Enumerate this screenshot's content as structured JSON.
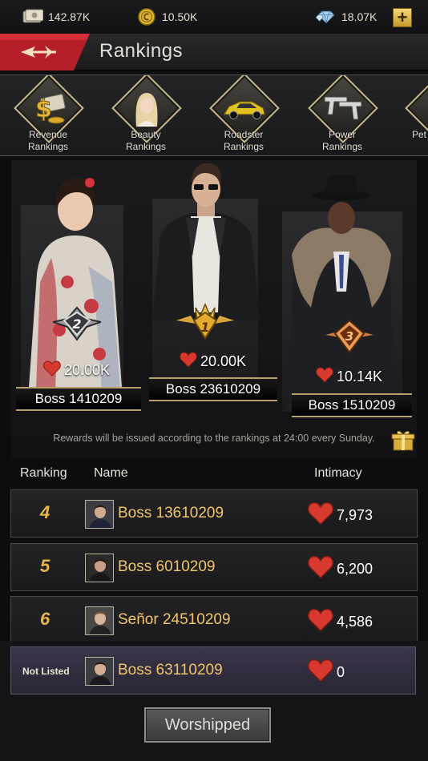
{
  "resources": {
    "money": "142.87K",
    "gold": "10.50K",
    "diamonds": "18.07K"
  },
  "header": {
    "title": "Rankings"
  },
  "categories": [
    {
      "label_line1": "Revenue",
      "label_line2": "Rankings",
      "icon": "money-icon"
    },
    {
      "label_line1": "Beauty",
      "label_line2": "Rankings",
      "icon": "beauty-icon"
    },
    {
      "label_line1": "Roadster",
      "label_line2": "Rankings",
      "icon": "car-icon"
    },
    {
      "label_line1": "Power",
      "label_line2": "Rankings",
      "icon": "guns-icon"
    },
    {
      "label_line1": "Pet",
      "label_line2": "",
      "icon": "pet-icon"
    }
  ],
  "podium": {
    "first": {
      "rank": "1",
      "likes": "20.00K",
      "name": "Boss 23610209"
    },
    "second": {
      "rank": "2",
      "likes": "20.00K",
      "name": "Boss 1410209"
    },
    "third": {
      "rank": "3",
      "likes": "10.14K",
      "name": "Boss 1510209"
    },
    "rewards_note": "Rewards will be issued according to the rankings at 24:00 every Sunday."
  },
  "table": {
    "headers": {
      "ranking": "Ranking",
      "name": "Name",
      "intimacy": "Intimacy"
    },
    "rows": [
      {
        "rank": "4",
        "name": "Boss 13610209",
        "intimacy": "7,973"
      },
      {
        "rank": "5",
        "name": "Boss 6010209",
        "intimacy": "6,200"
      },
      {
        "rank": "6",
        "name": "Señor 24510209",
        "intimacy": "4,586"
      }
    ]
  },
  "my_rank": {
    "status": "Not Listed",
    "name": "Boss 63110209",
    "intimacy": "0"
  },
  "worship_button": "Worshipped",
  "colors": {
    "gold_text": "#f0c46a",
    "rank_gold": "#e6b64a",
    "heart_red": "#d8392f",
    "title_red": "#c0202a",
    "frame_gold": "#c9b88a"
  }
}
